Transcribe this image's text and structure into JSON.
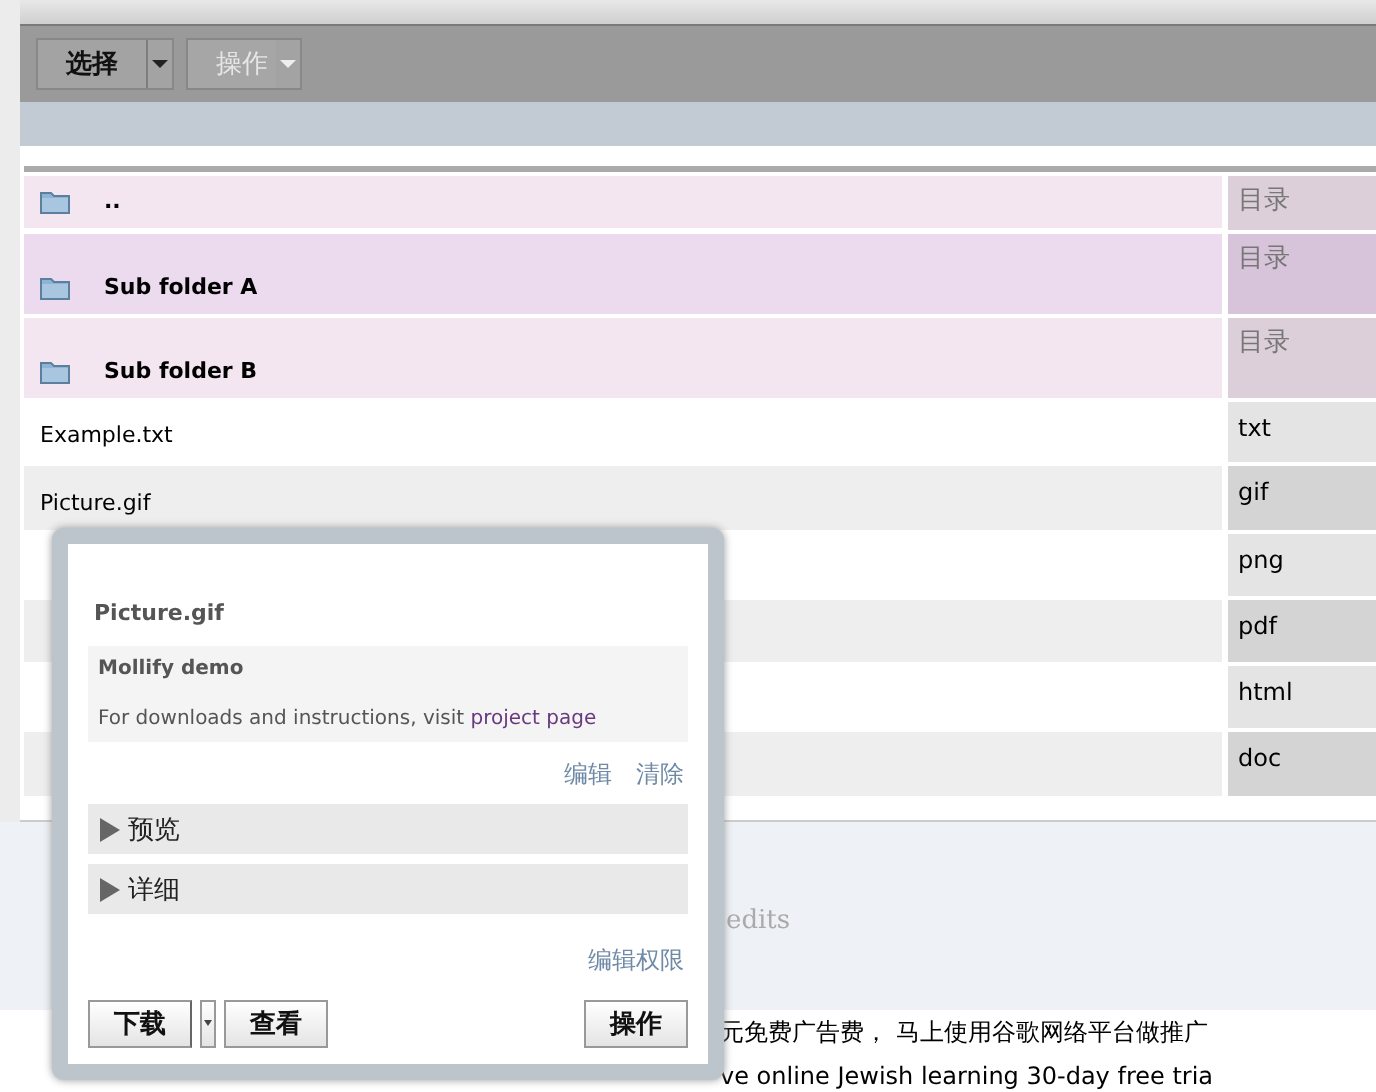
{
  "toolbar": {
    "buttons": [
      {
        "label": "选择",
        "disabled": false
      },
      {
        "label": "操作",
        "disabled": true
      }
    ]
  },
  "files": [
    {
      "kind": "folder",
      "name": "..",
      "type": "目录"
    },
    {
      "kind": "folder",
      "name": "Sub folder A",
      "type": "目录"
    },
    {
      "kind": "folder",
      "name": "Sub folder B",
      "type": "目录"
    },
    {
      "kind": "file",
      "name": "Example.txt",
      "type": "txt"
    },
    {
      "kind": "file",
      "name": "Picture.gif",
      "type": "gif"
    },
    {
      "kind": "file",
      "type": "png"
    },
    {
      "kind": "file",
      "type": "pdf"
    },
    {
      "kind": "file",
      "type": "html"
    },
    {
      "kind": "file",
      "type": "doc"
    }
  ],
  "page_footer": {
    "credits": "edits",
    "ads": [
      {
        "text": "元免费广告费， 马上使用谷歌网络平台做推广"
      },
      {
        "text": "ve online Jewish learning 30-day free tria"
      }
    ]
  },
  "popup": {
    "title": "Picture.gif",
    "notice": {
      "heading": "Mollify demo",
      "text": "For downloads and instructions, visit ",
      "link": "project page"
    },
    "actions": [
      "编辑",
      "清除"
    ],
    "sections": [
      {
        "label": "预览",
        "expanded": false
      },
      {
        "label": "详细",
        "expanded": false
      }
    ],
    "permissions_link": "编辑权限",
    "buttons": [
      {
        "label": "下载",
        "dropdown": true
      },
      {
        "label": "查看",
        "dropdown": false
      },
      {
        "label": "操作",
        "dropdown": false
      }
    ]
  }
}
